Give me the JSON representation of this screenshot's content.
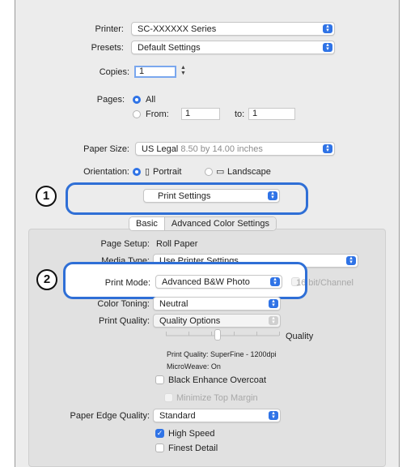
{
  "printer": {
    "label": "Printer:",
    "value": "SC-XXXXXX Series"
  },
  "presets": {
    "label": "Presets:",
    "value": "Default Settings"
  },
  "copies": {
    "label": "Copies:",
    "value": "1"
  },
  "pages": {
    "label": "Pages:",
    "all": "All",
    "from": "From:",
    "from_value": "1",
    "to": "to:",
    "to_value": "1"
  },
  "paper_size": {
    "label": "Paper Size:",
    "value": "US Legal",
    "detail": "8.50 by 14.00 inches"
  },
  "orientation": {
    "label": "Orientation:",
    "portrait": "Portrait",
    "landscape": "Landscape"
  },
  "section_popup": {
    "value": "Print Settings"
  },
  "tabs": [
    {
      "label": "Basic"
    },
    {
      "label": "Advanced Color Settings"
    }
  ],
  "page_setup": {
    "label": "Page Setup:",
    "value": "Roll Paper"
  },
  "media_type": {
    "label": "Media Type:",
    "value": "Use Printer Settings"
  },
  "print_mode": {
    "label": "Print Mode:",
    "value": "Advanced B&W Photo",
    "bit_label": "16 bit/Channel"
  },
  "color_toning": {
    "label": "Color Toning:",
    "value": "Neutral"
  },
  "print_quality": {
    "label": "Print Quality:",
    "value": "Quality Options",
    "slider_label": "Quality",
    "info_quality": "Print Quality: SuperFine - 1200dpi",
    "info_microweave": "MicroWeave: On"
  },
  "black_enhance": {
    "label": "Black Enhance Overcoat"
  },
  "minimize_margin": {
    "label": "Minimize Top Margin"
  },
  "paper_edge": {
    "label": "Paper Edge Quality:",
    "value": "Standard"
  },
  "high_speed": {
    "label": "High Speed",
    "checked": true
  },
  "finest_detail": {
    "label": "Finest Detail",
    "checked": false
  },
  "callouts": [
    {
      "number": "1"
    },
    {
      "number": "2"
    }
  ],
  "colors": {
    "accent": "#2f73e6",
    "callout": "#2f6fd6"
  }
}
